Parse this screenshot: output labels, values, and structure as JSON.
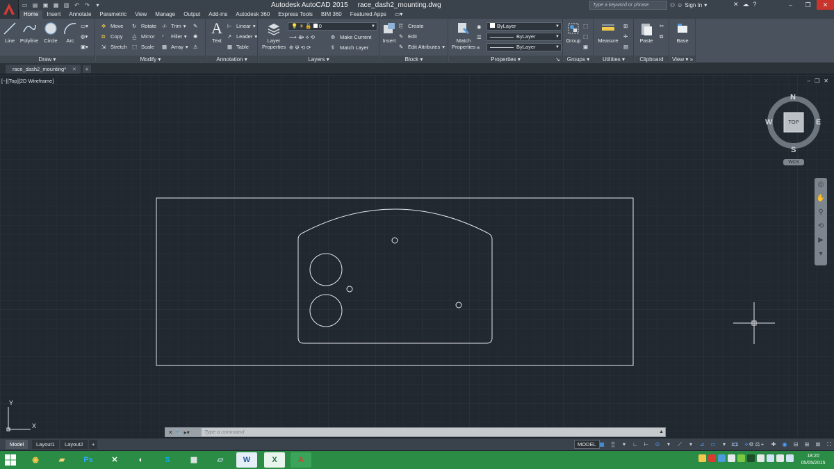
{
  "app": {
    "title": "Autodesk AutoCAD 2015",
    "file": "race_dash2_mounting.dwg",
    "search_placeholder": "Type a keyword or phrase",
    "sign_in": "Sign In"
  },
  "ribbon_tabs": [
    "Home",
    "Insert",
    "Annotate",
    "Parametric",
    "View",
    "Manage",
    "Output",
    "Add-ins",
    "Autodesk 360",
    "Express Tools",
    "BIM 360",
    "Featured Apps"
  ],
  "panels": {
    "draw": {
      "title": "Draw",
      "tools": [
        "Line",
        "Polyline",
        "Circle",
        "Arc"
      ]
    },
    "modify": {
      "title": "Modify",
      "tools": [
        "Move",
        "Rotate",
        "Trim",
        "Copy",
        "Mirror",
        "Fillet",
        "Stretch",
        "Scale",
        "Array"
      ]
    },
    "annotation": {
      "title": "Annotation",
      "text": "Text",
      "linear": "Linear",
      "leader": "Leader",
      "table": "Table"
    },
    "layers": {
      "title": "Layers",
      "layer_props": "Layer Properties",
      "current_layer": "0",
      "make_current": "Make Current",
      "match_layer": "Match Layer"
    },
    "block": {
      "title": "Block",
      "insert": "Insert",
      "create": "Create",
      "edit": "Edit",
      "edit_attributes": "Edit Attributes"
    },
    "properties": {
      "title": "Properties",
      "match_props": "Match Properties",
      "color": "ByLayer",
      "linetype": "ByLayer",
      "lineweight": "ByLayer"
    },
    "groups": {
      "title": "Groups",
      "group": "Group"
    },
    "utilities": {
      "title": "Utilities",
      "measure": "Measure"
    },
    "clipboard": {
      "title": "Clipboard",
      "paste": "Paste"
    },
    "view": {
      "title": "View",
      "base": "Base"
    }
  },
  "doc_tab": "race_dash2_mounting*",
  "viewport": {
    "label": "[−][Top][2D Wireframe]",
    "viewcube": {
      "n": "N",
      "s": "S",
      "e": "E",
      "w": "W",
      "face": "TOP"
    },
    "wcs": "WCS",
    "ucs_x": "X",
    "ucs_y": "Y"
  },
  "command_placeholder": "Type a command",
  "layout_tabs": [
    "Model",
    "Layout1",
    "Layout2"
  ],
  "status": {
    "model": "MODEL",
    "scale": "1:1"
  },
  "clock": {
    "time": "18:20",
    "date": "05/05/2015"
  },
  "colors": {
    "accent": "#c9342c",
    "background": "#212830",
    "ribbon": "#4a535d",
    "taskbar": "#2a8c45"
  }
}
